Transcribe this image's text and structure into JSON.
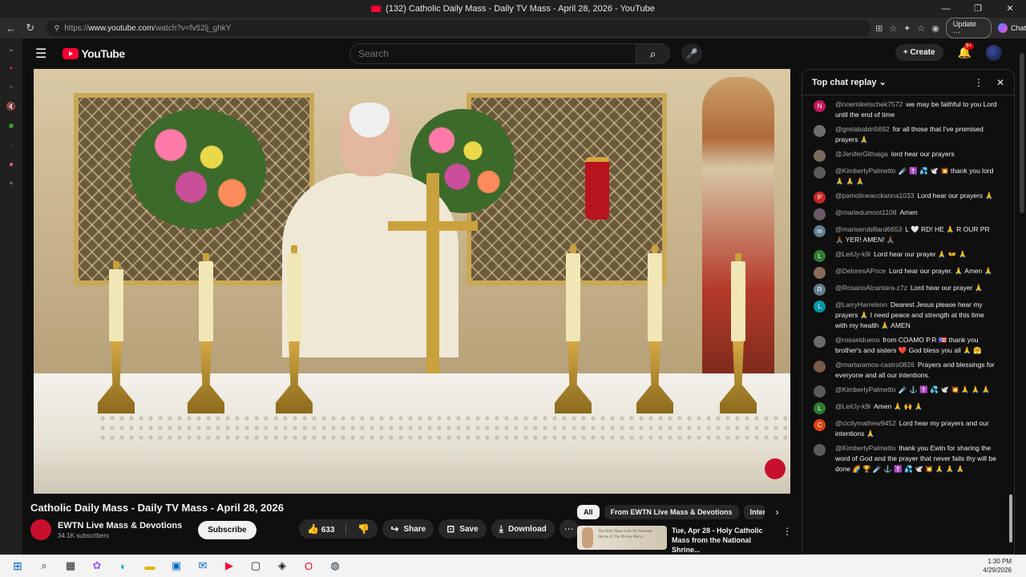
{
  "window": {
    "title": "(132) Catholic Daily Mass - Daily TV Mass - April 28, 2026 - YouTube"
  },
  "browser": {
    "url_scheme": "https://",
    "url_host": "www.youtube.com",
    "url_path": "/watch?v=fv52lj_ghkY",
    "update_label": "Update",
    "chat_label": "Chat"
  },
  "masthead": {
    "logo_text": "YouTube",
    "search_placeholder": "Search",
    "create_label": "Create",
    "notifications_badge": "9+"
  },
  "video": {
    "title": "Catholic Daily Mass - Daily TV Mass - April 28, 2026",
    "channel_name": "EWTN Live Mass & Devotions",
    "subscribers": "34.1K subscribers",
    "subscribe_label": "Subscribe",
    "like_count": "633",
    "share_label": "Share",
    "save_label": "Save",
    "download_label": "Download",
    "thumb_text": "The Holy Mass from the National Shrine of The Divine Mercy"
  },
  "recommendations": {
    "chips": [
      "All",
      "From EWTN Live Mass & Devotions",
      "Interr"
    ],
    "items": [
      {
        "title": "Tue, Apr 28 - Holy Catholic Mass from the National Shrine..."
      }
    ]
  },
  "chat": {
    "title": "Top chat replay",
    "messages": [
      {
        "initial": "N",
        "color": "#c2185b",
        "author": "@noemiketschek7572",
        "text": "we may be faithful to you Lord until the end of time"
      },
      {
        "initial": "",
        "color": "#6d6d6d",
        "author": "@gretababin5692",
        "text": "for all those that I've promised prayers 🙏"
      },
      {
        "initial": "",
        "color": "#7a6a5a",
        "author": "@JeniferGithaiga",
        "text": "lord hear our prayers"
      },
      {
        "initial": "",
        "color": "#5a5a5a",
        "author": "@KimberlyPalmetto",
        "text": "☄️ ✝️ 💦 🕊️ 💥 thank you lord 🙏 🙏 🙏"
      },
      {
        "initial": "P",
        "color": "#c62828",
        "author": "@pamolineacckanna1033",
        "text": "Lord hear our prayers 🙏"
      },
      {
        "initial": "",
        "color": "#6a5a6a",
        "author": "@mariedumont1108",
        "text": "Amen"
      },
      {
        "initial": "m",
        "color": "#607d8b",
        "author": "@mariserobillard6653",
        "text": "L 🤍 RD! HE 🙏 R OUR PR 🙏🏾 YER! AMEN! 🙏🏾"
      },
      {
        "initial": "L",
        "color": "#2e7d32",
        "author": "@LeiUy-k9i",
        "text": "Lord hear our prayer 🙏 👐 🙏"
      },
      {
        "initial": "",
        "color": "#8a6a5a",
        "author": "@DeloresAPrice",
        "text": "Lord hear our prayer. 🙏 Amen 🙏"
      },
      {
        "initial": "R",
        "color": "#607d8b",
        "author": "@RosarioAlcantara-z7z",
        "text": "Lord hear our prayer 🙏"
      },
      {
        "initial": "L",
        "color": "#0097a7",
        "author": "@LarryHarrelson",
        "text": "Dearest Jesus please hear my prayers 🙏 I need peace and strength at this time with my health 🙏 AMEN"
      },
      {
        "initial": "",
        "color": "#6a6a6a",
        "author": "@rosaeldueno",
        "text": "from COAMO P.R 🇵🇷 thank you brother's and sisters ❤️ God bless you all 🙏 🤗"
      },
      {
        "initial": "",
        "color": "#7a5a4a",
        "author": "@martaramos-castro0826",
        "text": "Prayers and blessings for everyone and all our intentions."
      },
      {
        "initial": "",
        "color": "#5a5a5a",
        "author": "@KimberlyPalmetto",
        "text": "☄️ ⚓ ✝️ 💦 🕊️ 💥 🙏 🙏 🙏"
      },
      {
        "initial": "L",
        "color": "#2e7d32",
        "author": "@LeiUy-k9i",
        "text": "Amen 🙏 🙌 🙏"
      },
      {
        "initial": "C",
        "color": "#d84315",
        "author": "@cicilymathew9452",
        "text": "Lord hear my prayers and our intentions 🙏"
      },
      {
        "initial": "",
        "color": "#5a5a5a",
        "author": "@KimberlyPalmetto",
        "text": "thank you Ewtn for sharing the word of God and the prayer that never fails thy will be done 🌈 🏆 ☄️ ⚓ ✝️ 💦 🕊️ 💥 🙏 🙏 🙏"
      }
    ]
  },
  "taskbar": {
    "time": "1:30 PM",
    "date": "4/29/2026"
  }
}
